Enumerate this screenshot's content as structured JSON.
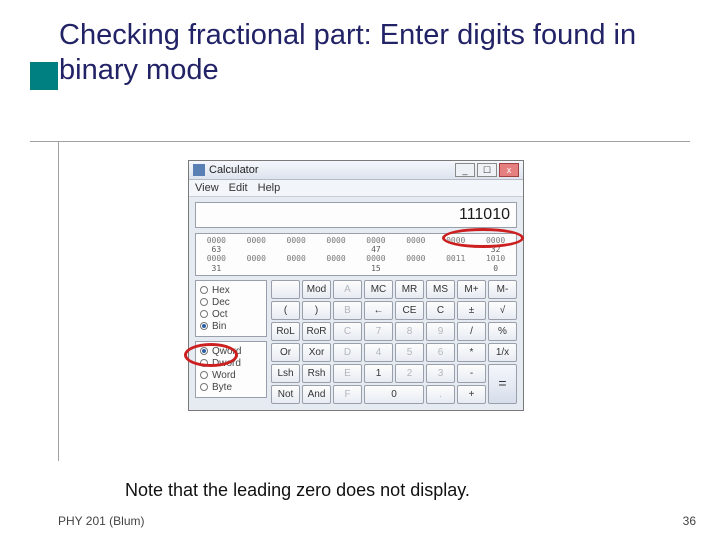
{
  "slide": {
    "title": "Checking fractional part: Enter digits found in binary mode",
    "note": "Note that the leading zero does not display.",
    "footer_left": "PHY 201 (Blum)",
    "page_number": "36"
  },
  "calc": {
    "window_title": "Calculator",
    "menu": {
      "view": "View",
      "edit": "Edit",
      "help": "Help"
    },
    "display": "111010",
    "bits": {
      "row1": [
        "0000",
        "0000",
        "0000",
        "0000",
        "0000",
        "0000",
        "0000",
        "0000"
      ],
      "idx1": [
        "63",
        "",
        "",
        "",
        "47",
        "",
        "",
        "32"
      ],
      "row2": [
        "0000",
        "0000",
        "0000",
        "0000",
        "0000",
        "0000",
        "0011",
        "1010"
      ],
      "idx2": [
        "31",
        "",
        "",
        "",
        "15",
        "",
        "",
        "0"
      ]
    },
    "bases": {
      "hex": "Hex",
      "dec": "Dec",
      "oct": "Oct",
      "bin": "Bin"
    },
    "words": {
      "qword": "Qword",
      "dword": "Dword",
      "word": "Word",
      "byte": "Byte"
    },
    "btns": {
      "blank": "",
      "mod": "Mod",
      "a": "A",
      "mc": "MC",
      "mr": "MR",
      "ms": "MS",
      "mplus": "M+",
      "mminus": "M-",
      "lpar": "(",
      "rpar": ")",
      "b": "B",
      "back": "←",
      "ce": "CE",
      "c": "C",
      "pm": "±",
      "sqrt": "√",
      "rol": "RoL",
      "ror": "RoR",
      "cc": "C",
      "d7": "7",
      "d8": "8",
      "d9": "9",
      "div": "/",
      "pct": "%",
      "or": "Or",
      "xor": "Xor",
      "d": "D",
      "d4": "4",
      "d5": "5",
      "d6": "6",
      "mul": "*",
      "inv": "1/x",
      "lsh": "Lsh",
      "rsh": "Rsh",
      "e": "E",
      "d1": "1",
      "d2": "2",
      "d3": "3",
      "sub": "-",
      "eq": "=",
      "not": "Not",
      "and": "And",
      "f": "F",
      "d0": "0",
      "dot": ".",
      "add": "+"
    }
  }
}
